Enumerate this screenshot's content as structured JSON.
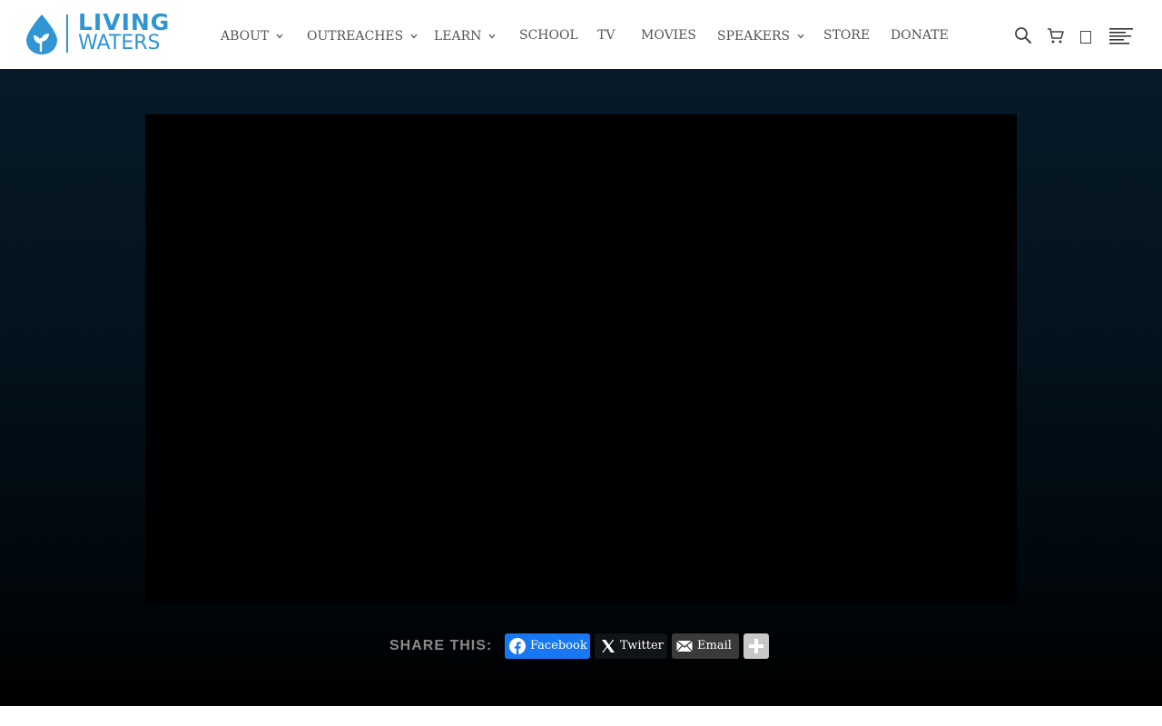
{
  "brand": {
    "line1": "LIVING",
    "line2": "WATERS",
    "color": "#2f95d3"
  },
  "nav": {
    "about": "ABOUT",
    "outreaches": "OUTREACHES",
    "learn": "LEARN",
    "school": "SCHOOL",
    "tv": "TV",
    "movies": "MOVIES",
    "speakers": "SPEAKERS",
    "store": "STORE",
    "donate": "DONATE"
  },
  "icons": {
    "search": "search-icon",
    "cart": "cart-icon",
    "account": "account-icon",
    "menu": "hamburger-menu-icon"
  },
  "share": {
    "label": "SHARE THIS:",
    "facebook": "Facebook",
    "twitter": "Twitter",
    "email": "Email",
    "colors": {
      "facebook": "#1877f2",
      "twitter": "#111417",
      "email": "#3a3a3a",
      "more": "#c8c8c8"
    }
  }
}
